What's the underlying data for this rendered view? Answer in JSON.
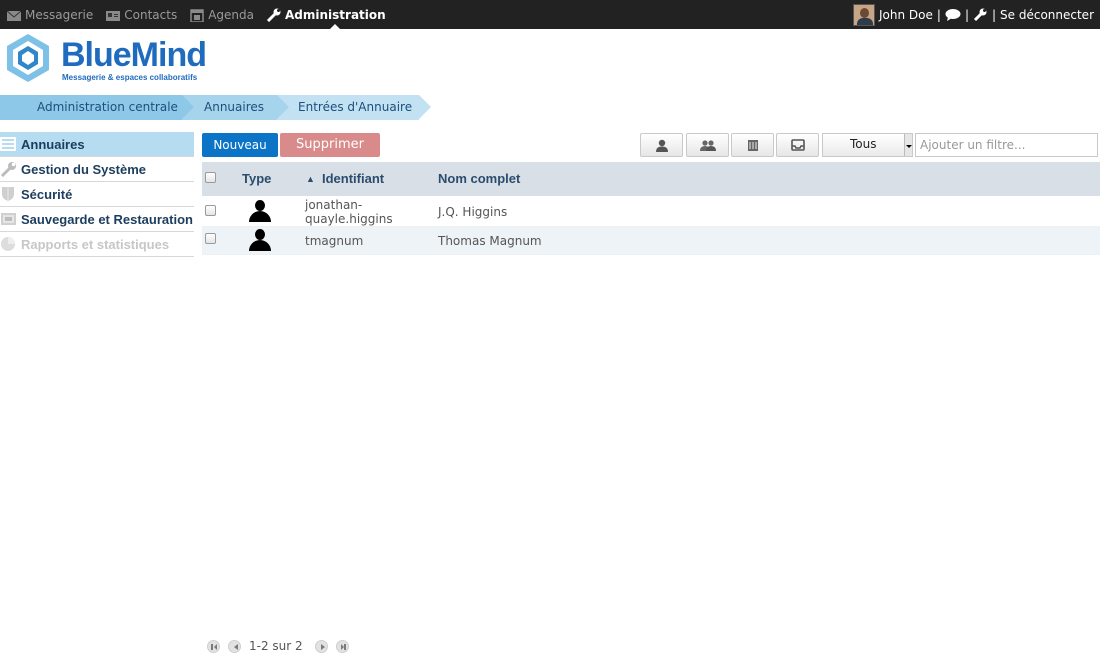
{
  "topnav": {
    "items": [
      {
        "label": "Messagerie",
        "icon": "mail-icon"
      },
      {
        "label": "Contacts",
        "icon": "contacts-icon"
      },
      {
        "label": "Agenda",
        "icon": "calendar-icon"
      },
      {
        "label": "Administration",
        "icon": "wrench-icon",
        "active": true
      }
    ]
  },
  "user": {
    "name": "John Doe",
    "separator": "|",
    "logout": "Se déconnecter"
  },
  "logo": {
    "name": "BlueMind",
    "tagline": "Messagerie & espaces collaboratifs"
  },
  "breadcrumb": [
    "Administration centrale",
    "Annuaires",
    "Entrées d'Annuaire"
  ],
  "sidebar": {
    "items": [
      {
        "label": "Annuaires",
        "icon": "directory-icon",
        "active": true
      },
      {
        "label": "Gestion du Système",
        "icon": "wrench-icon"
      },
      {
        "label": "Sécurité",
        "icon": "shield-icon"
      },
      {
        "label": "Sauvegarde et Restauration",
        "icon": "backup-icon"
      },
      {
        "label": "Rapports et statistiques",
        "icon": "reports-icon",
        "disabled": true
      }
    ]
  },
  "toolbar": {
    "new_label": "Nouveau",
    "delete_label": "Supprimer",
    "filter_select": "Tous",
    "filter_placeholder": "Ajouter un filtre...",
    "type_filters": [
      "user-filter-icon",
      "group-filter-icon",
      "resource-filter-icon",
      "mailbox-filter-icon"
    ]
  },
  "table": {
    "columns": [
      "Type",
      "Identifiant",
      "Nom complet"
    ],
    "sort_indicator": "▲",
    "rows": [
      {
        "type": "user-icon",
        "identifiant": "jonathan-\nquayle.higgins",
        "nom": "J.Q. Higgins"
      },
      {
        "type": "user-icon",
        "identifiant": "tmagnum",
        "nom": "Thomas Magnum"
      }
    ]
  },
  "pager": {
    "text": "1-2 sur 2"
  },
  "colors": {
    "topbar": "#222222",
    "brand": "#1f6bbd",
    "primary_button": "#0b74c6",
    "danger_button": "#d98a8a",
    "menu_active": "#b5dcf0"
  }
}
